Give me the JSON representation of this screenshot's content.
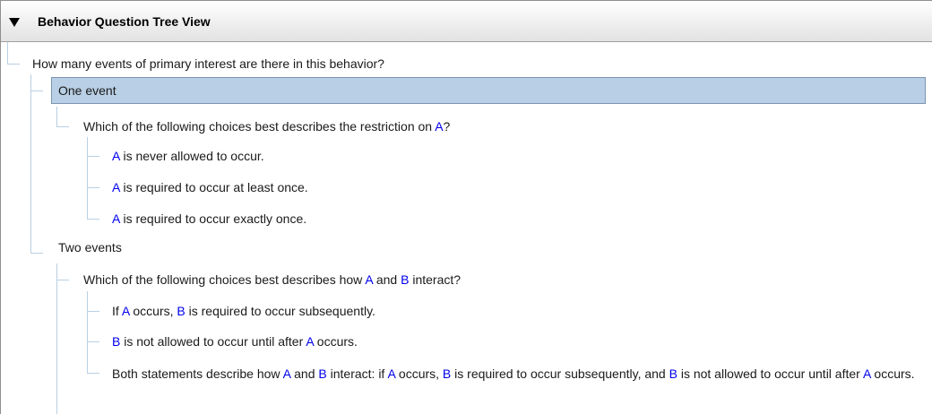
{
  "panel": {
    "title": "Behavior Question Tree View",
    "collapse_icon": "triangle-down-icon"
  },
  "colors": {
    "selection_bg": "#b8cfe5",
    "selection_border": "#7a95b2",
    "connector": "#b9cfe2",
    "variable": "#0000ee"
  },
  "tree": {
    "root": "How many events of primary interest are there in this behavior?",
    "one_event": {
      "label": "One event",
      "question": {
        "pre": "Which of the following choices best describes the restriction on ",
        "v1": "A",
        "post": "?"
      },
      "answers": [
        {
          "v": "A",
          "text": " is never allowed to occur."
        },
        {
          "v": "A",
          "text": " is required to occur at least once."
        },
        {
          "v": "A",
          "text": " is required to occur exactly once."
        }
      ]
    },
    "two_events": {
      "label": "Two events",
      "question": {
        "pre": "Which of the following choices best describes how ",
        "v1": "A",
        "mid": " and ",
        "v2": "B",
        "post": " interact?"
      },
      "answer1": {
        "t0": "If ",
        "v1": "A",
        "t1": " occurs, ",
        "v2": "B",
        "t2": " is required to occur subsequently."
      },
      "answer2": {
        "v1": "B",
        "t1": " is not allowed to occur until after ",
        "v2": "A",
        "t2": " occurs."
      },
      "answer3": {
        "t0": "Both statements describe how ",
        "v1": "A",
        "t1": " and ",
        "v2": "B",
        "t2": " interact: if ",
        "v3": "A",
        "t3": " occurs, ",
        "v4": "B",
        "t4": " is required to occur subsequently, and ",
        "v5": "B",
        "t5": " is not allowed to occur until after ",
        "v6": "A",
        "t6": " occurs."
      }
    }
  }
}
